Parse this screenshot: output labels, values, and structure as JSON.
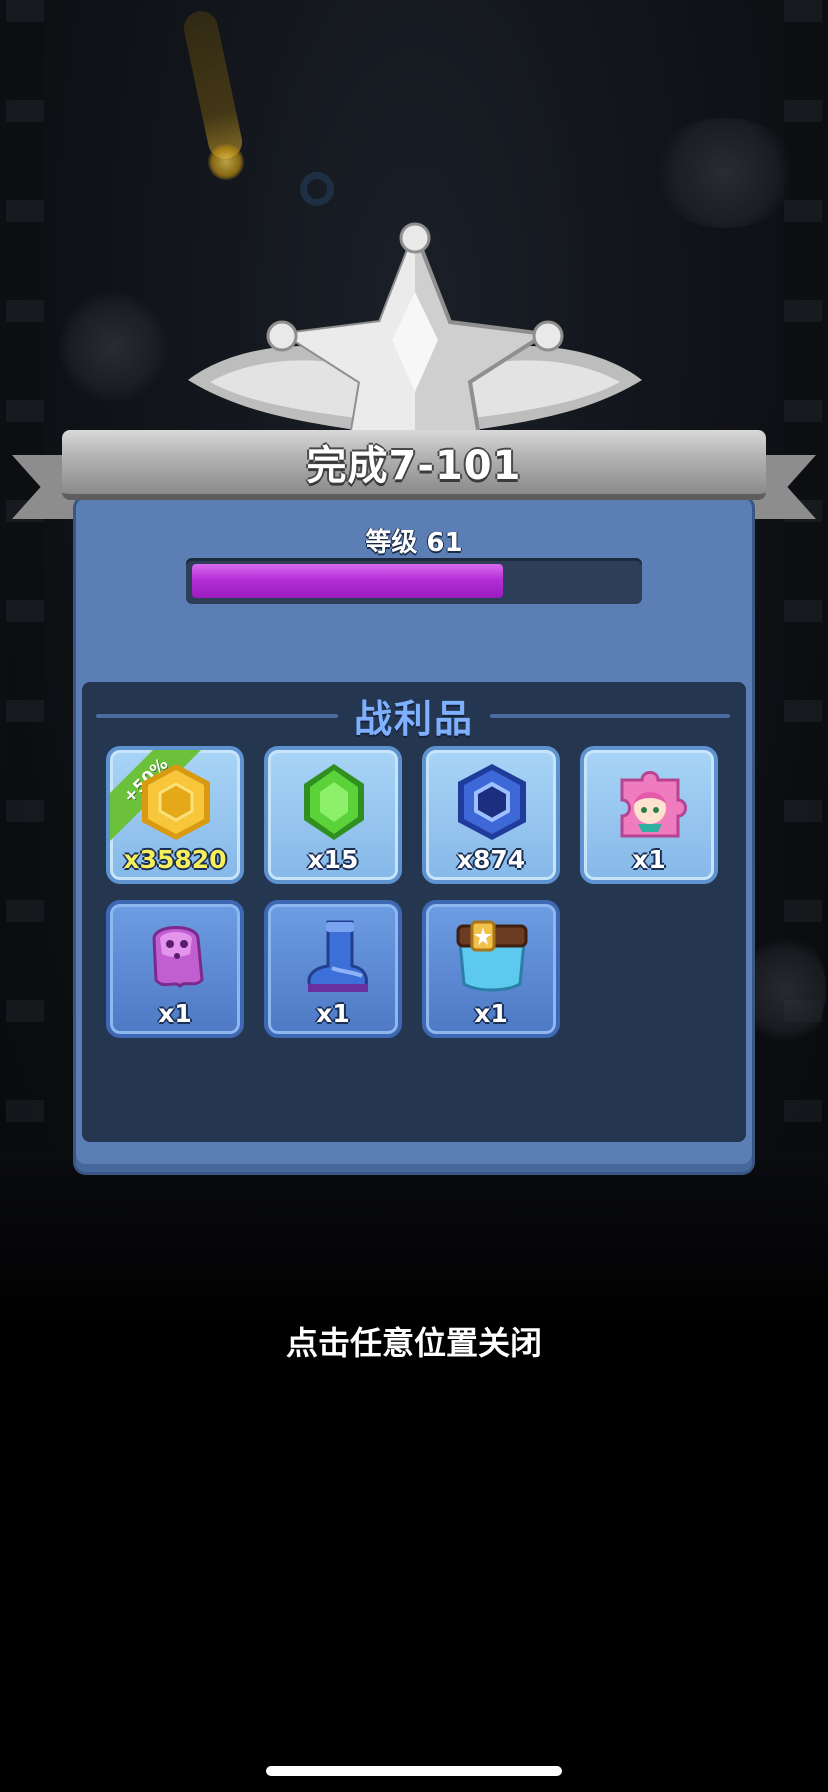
{
  "header": {
    "title": "完成7-101"
  },
  "level": {
    "label": "等级 61",
    "progress": 0.7
  },
  "loot": {
    "title": "战利品",
    "bonus": "+50%",
    "items": [
      {
        "icon": "gold-hexagon-coin-icon",
        "quantity": "x35820"
      },
      {
        "icon": "green-gem-icon",
        "quantity": "x15"
      },
      {
        "icon": "blue-hexagon-token-icon",
        "quantity": "x874"
      },
      {
        "icon": "hero-puzzle-piece-icon",
        "quantity": "x1"
      },
      {
        "icon": "purple-ghost-gear-icon",
        "quantity": "x1"
      },
      {
        "icon": "blue-boot-icon",
        "quantity": "x1"
      },
      {
        "icon": "star-belt-icon",
        "quantity": "x1"
      }
    ]
  },
  "footer": {
    "close_hint": "点击任意位置关闭"
  },
  "colors": {
    "panel": "#5b7fb5",
    "loot_bg": "#243650",
    "progress": "#b32fd7",
    "loot_title": "#7fb0ff",
    "bonus_tag": "#6cc13a"
  }
}
